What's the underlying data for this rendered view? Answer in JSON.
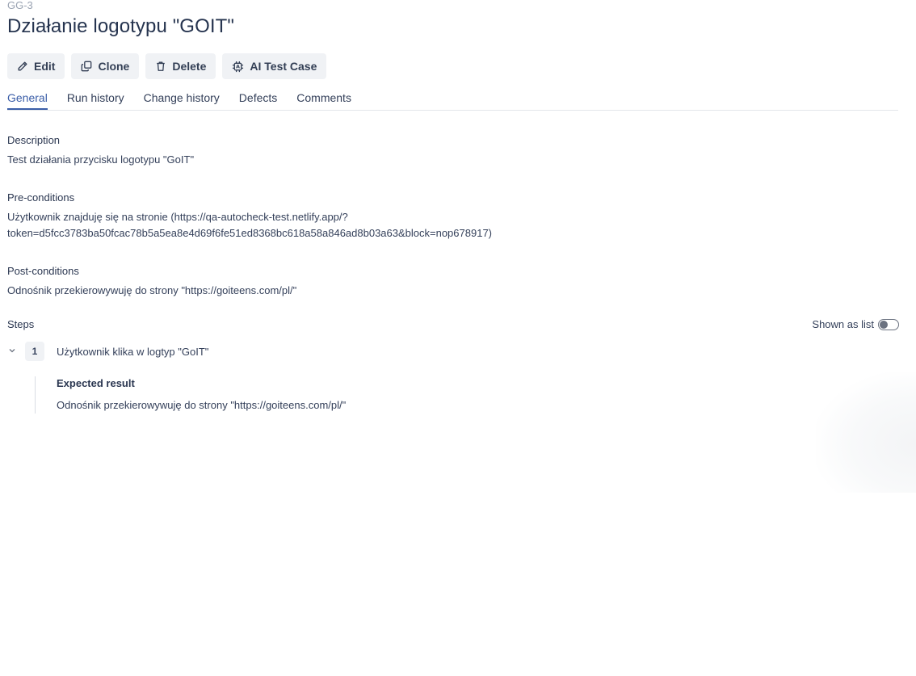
{
  "case": {
    "id": "GG-3",
    "title": "Działanie logotypu \"GOIT\""
  },
  "toolbar": {
    "edit_label": "Edit",
    "clone_label": "Clone",
    "delete_label": "Delete",
    "ai_label": "AI Test Case"
  },
  "tabs": [
    {
      "label": "General",
      "active": true
    },
    {
      "label": "Run history",
      "active": false
    },
    {
      "label": "Change history",
      "active": false
    },
    {
      "label": "Defects",
      "active": false
    },
    {
      "label": "Comments",
      "active": false
    }
  ],
  "description": {
    "label": "Description",
    "text": "Test działania przycisku logotypu \"GoIT\""
  },
  "preconditions": {
    "label": "Pre-conditions",
    "line1": "Użytkownik znajduję się na stronie (https://qa-autocheck-test.netlify.app/?",
    "line2": "token=d5fcc3783ba50fcac78b5a5ea8e4d69f6fe51ed8368bc618a58a846ad8b03a63&block=nop678917)"
  },
  "postconditions": {
    "label": "Post-conditions",
    "text": "Odnośnik przekierowywuję do strony \"https://goiteens.com/pl/\""
  },
  "steps": {
    "label": "Steps",
    "toggle_label": "Shown as list",
    "toggle_on": false,
    "items": [
      {
        "number": "1",
        "text": "Użytkownik klika w logtyp \"GoIT\"",
        "expected_label": "Expected result",
        "expected_text": "Odnośnik przekierowywuję do strony \"https://goiteens.com/pl/\""
      }
    ]
  },
  "icons": {
    "edit": "pencil-icon",
    "clone": "copy-icon",
    "delete": "trash-icon",
    "ai": "chip-icon",
    "expand": "chevron-down-icon"
  },
  "colors": {
    "accent": "#3b5ea8",
    "text": "#26344f",
    "button_bg": "#f0f2f5"
  }
}
